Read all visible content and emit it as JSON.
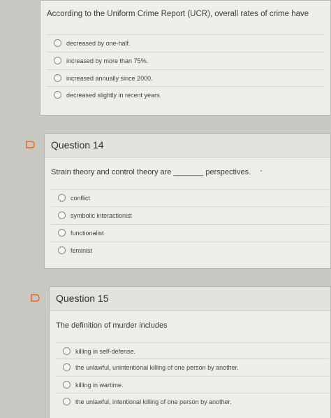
{
  "question_13": {
    "prompt": "According to the Uniform Crime Report (UCR), overall rates of crime have",
    "options": [
      "decreased by one-half.",
      "increased by more than 75%.",
      "increased annually since 2000.",
      "decreased slightly in recent years."
    ]
  },
  "question_14": {
    "title": "Question 14",
    "prompt": "Strain theory and control theory are _______ perspectives.",
    "options": [
      "conflict",
      "symbolic interactionist",
      "functionalist",
      "feminist"
    ]
  },
  "question_15": {
    "title": "Question 15",
    "prompt": "The definition of murder includes",
    "options": [
      "killing in self-defense.",
      "the unlawful, unintentional killing of one person by another.",
      "killing in wartime.",
      "the unlawful, intentional killing of one person by another."
    ]
  },
  "colors": {
    "flag_accent": "#e46a2a",
    "page_background": "#c9c7c2"
  }
}
